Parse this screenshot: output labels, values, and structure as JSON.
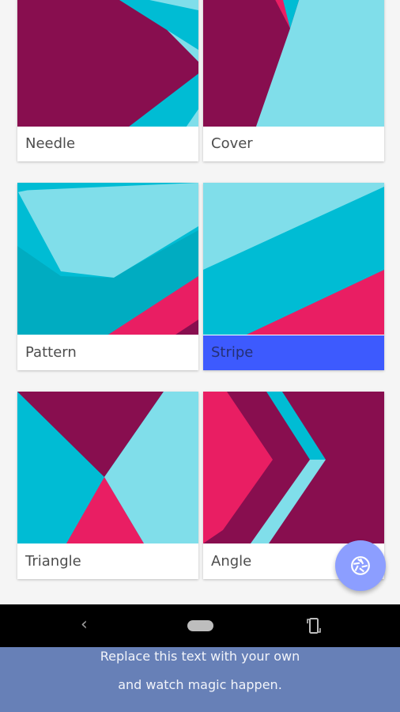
{
  "cards": [
    {
      "name": "Needle",
      "selected": false
    },
    {
      "name": "Cover",
      "selected": false
    },
    {
      "name": "Pattern",
      "selected": false
    },
    {
      "name": "Stripe",
      "selected": true
    },
    {
      "name": "Triangle",
      "selected": false
    },
    {
      "name": "Angle",
      "selected": false
    }
  ],
  "fab": {
    "icon": "camera-shutter-icon"
  },
  "navbar": {
    "back_icon": "back-chevron-icon",
    "home_icon": "home-pill-icon",
    "rotate_icon": "rotate-screen-icon"
  },
  "banner": {
    "line1": "Replace this text with your own",
    "line2": "and watch magic happen."
  },
  "colors": {
    "magenta": "#880e4f",
    "pink": "#e91e63",
    "cyan": "#00bcd4",
    "light_cyan": "#80deea",
    "teal": "#00acc1",
    "selected_label_bg": "#3d5afe",
    "fab_bg": "#8c9eff",
    "banner_bg": "#6780b7"
  }
}
